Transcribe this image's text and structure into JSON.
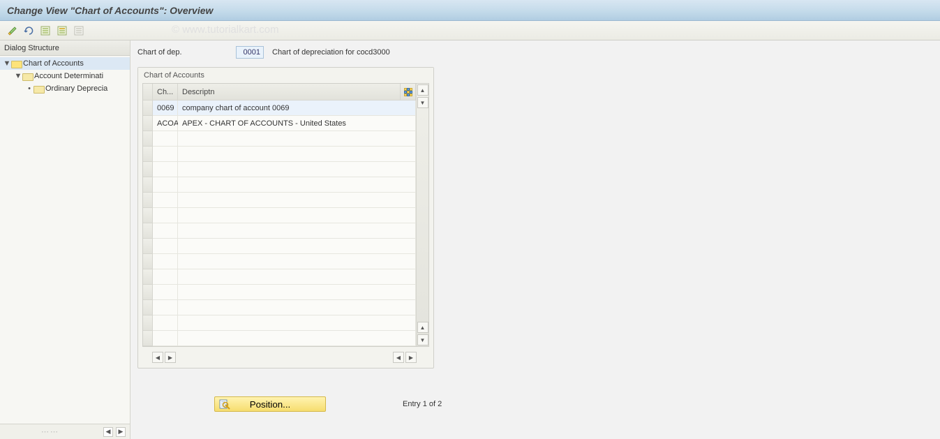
{
  "title": "Change View \"Chart of Accounts\": Overview",
  "watermark": "© www.tutorialkart.com",
  "toolbar": {
    "icons": [
      "edit-pencils-icon",
      "undo-icon",
      "select-all-icon",
      "save-variant-icon",
      "deselect-icon"
    ]
  },
  "left_panel": {
    "header": "Dialog Structure",
    "tree": [
      {
        "label": "Chart of Accounts",
        "level": 0,
        "open": true,
        "selected": true
      },
      {
        "label": "Account Determinati",
        "level": 1,
        "open": true,
        "selected": false
      },
      {
        "label": "Ordinary Deprecia",
        "level": 2,
        "open": false,
        "selected": false
      }
    ]
  },
  "field": {
    "label": "Chart of dep.",
    "value": "0001",
    "text": "Chart of depreciation for cocd3000"
  },
  "table": {
    "title": "Chart of Accounts",
    "columns": {
      "ch": "Ch...",
      "desc": "Descriptn"
    },
    "rows": [
      {
        "ch": "0069",
        "desc": "company chart of account 0069",
        "selected": true
      },
      {
        "ch": "ACOA",
        "desc": "APEX - CHART OF ACCOUNTS - United States",
        "selected": false
      }
    ],
    "empty_rows": 14
  },
  "footer": {
    "position_label": "Position...",
    "entry_text": "Entry 1 of 2"
  }
}
